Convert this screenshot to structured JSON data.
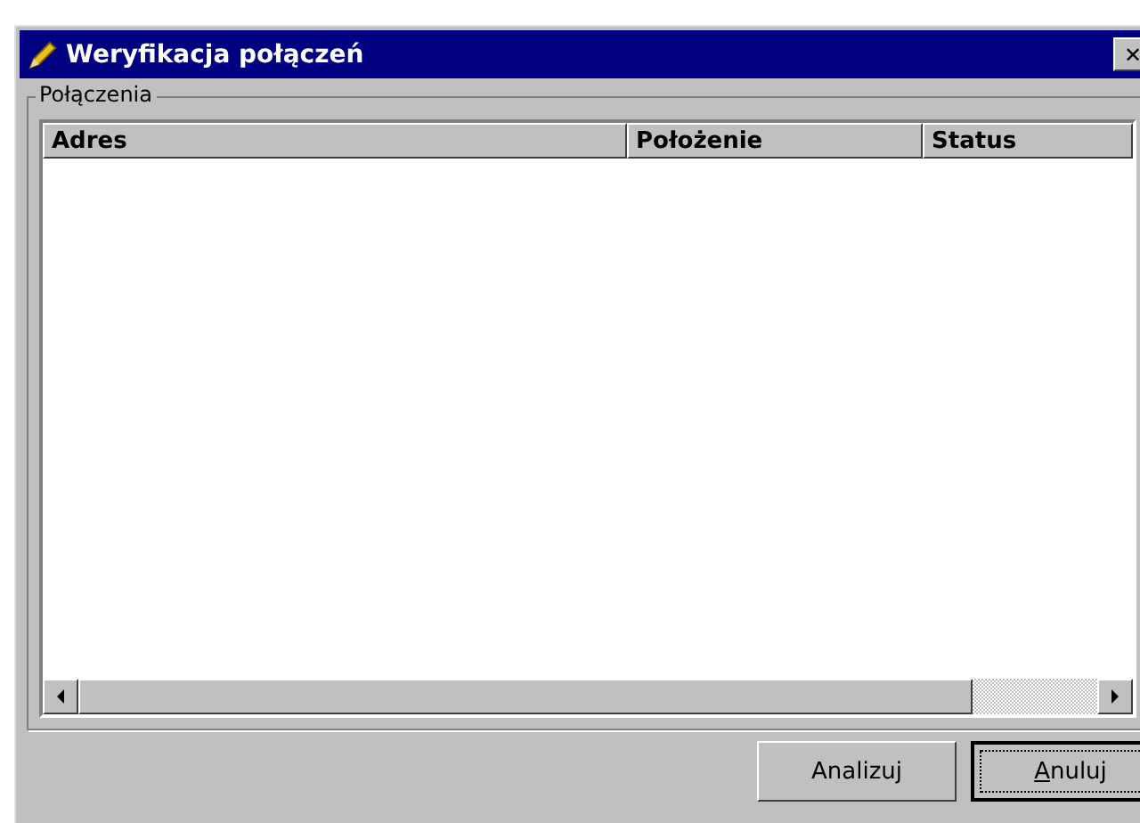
{
  "window": {
    "title": "Weryfikacja połączeń",
    "close": "✕"
  },
  "group": {
    "label": "Połączenia"
  },
  "table": {
    "columns": [
      "Adres",
      "Położenie",
      "Status"
    ]
  },
  "buttons": [
    {
      "label": "Analizuj",
      "default": false
    },
    {
      "label": "Anuluj",
      "default": true
    }
  ]
}
